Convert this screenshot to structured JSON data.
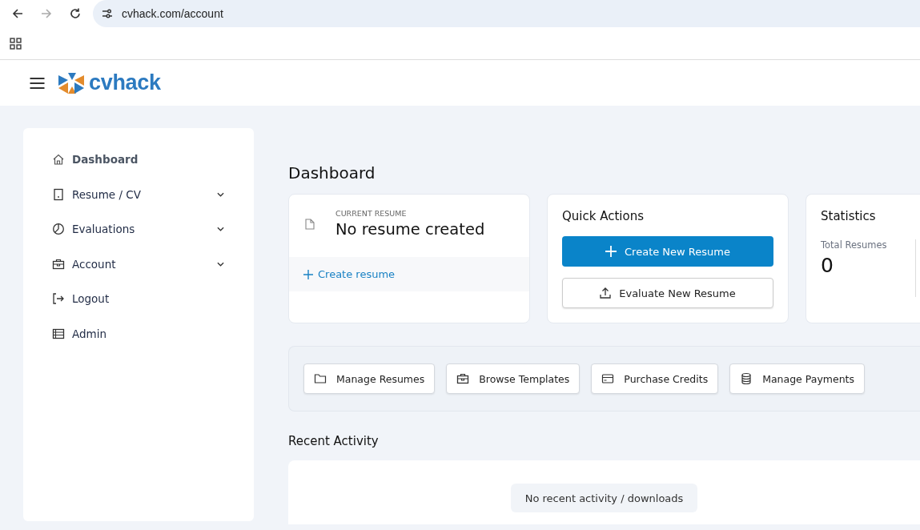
{
  "browser": {
    "url": "cvhack.com/account"
  },
  "header": {
    "logo": "cvhack"
  },
  "sidebar": {
    "items": [
      {
        "label": "Dashboard",
        "selected": true,
        "expandable": false
      },
      {
        "label": "Resume / CV",
        "selected": false,
        "expandable": true
      },
      {
        "label": "Evaluations",
        "selected": false,
        "expandable": true
      },
      {
        "label": "Account",
        "selected": false,
        "expandable": true
      },
      {
        "label": "Logout",
        "selected": false,
        "expandable": false
      },
      {
        "label": "Admin",
        "selected": false,
        "expandable": false
      }
    ]
  },
  "page_title": "Dashboard",
  "current_resume": {
    "label": "CURRENT RESUME",
    "value": "No resume created",
    "link": "Create resume"
  },
  "quick_actions": {
    "title": "Quick Actions",
    "buttons": [
      {
        "label": "Create New Resume",
        "kind": "primary"
      },
      {
        "label": "Evaluate New Resume",
        "kind": "secondary"
      }
    ]
  },
  "statistics": {
    "title": "Statistics",
    "stats": [
      {
        "label": "Total Resumes",
        "value": "0"
      }
    ]
  },
  "shortcuts": [
    {
      "label": "Manage Resumes"
    },
    {
      "label": "Browse Templates"
    },
    {
      "label": "Purchase Credits"
    },
    {
      "label": "Manage Payments"
    }
  ],
  "recent_activity": {
    "title": "Recent Activity",
    "empty_message": "No recent activity / downloads"
  }
}
